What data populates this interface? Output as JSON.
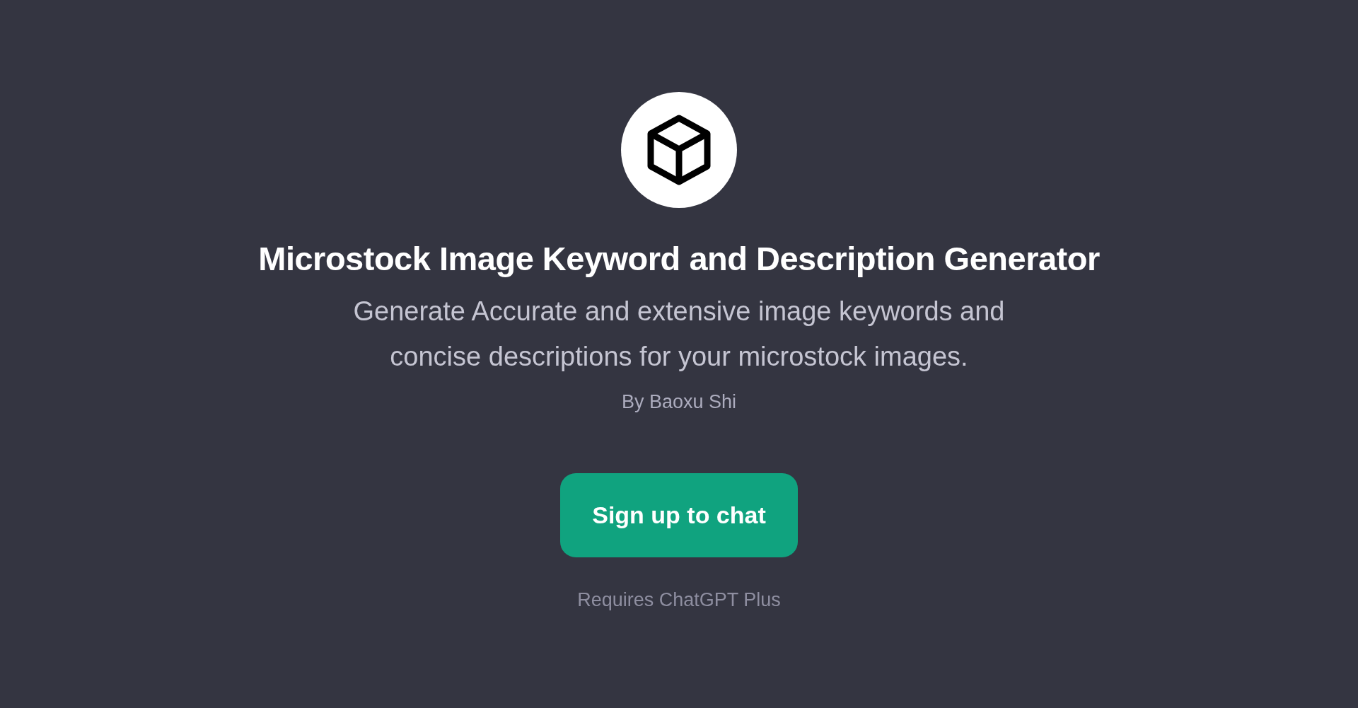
{
  "gpt": {
    "title": "Microstock Image Keyword and Description Generator",
    "description": "Generate Accurate and extensive image keywords and concise descriptions for your microstock images.",
    "author": "By Baoxu Shi"
  },
  "signup_button": "Sign up to chat",
  "note": "Requires ChatGPT Plus"
}
